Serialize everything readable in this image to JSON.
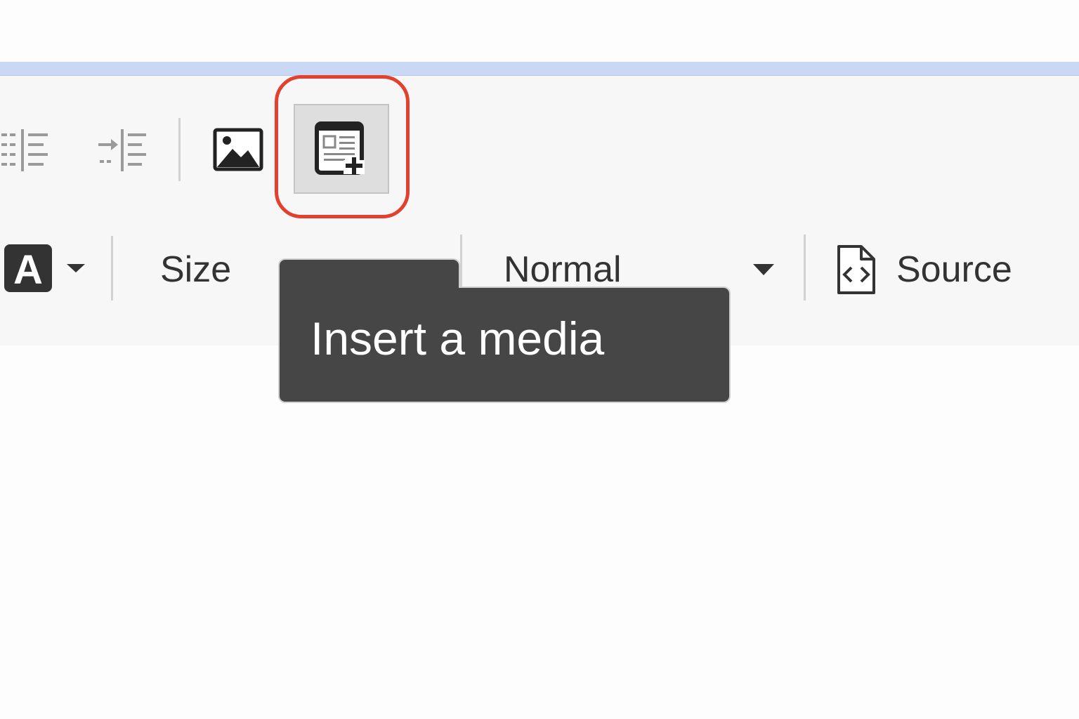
{
  "toolbar": {
    "row1": {
      "outdent_icon": "outdent-icon",
      "indent_icon": "indent-icon",
      "image_icon": "image-icon",
      "insert_media_icon": "insert-media-icon"
    },
    "row2": {
      "text_color_letter": "A",
      "size_label": "Size",
      "format_label": "Normal",
      "source_label": "Source"
    }
  },
  "tooltip": {
    "text": "Insert a media"
  },
  "colors": {
    "highlight": "#e2412e",
    "tooltip_bg": "#464646",
    "toolbar_bg": "#f7f7f7",
    "editor_border": "#c9d8f5"
  }
}
